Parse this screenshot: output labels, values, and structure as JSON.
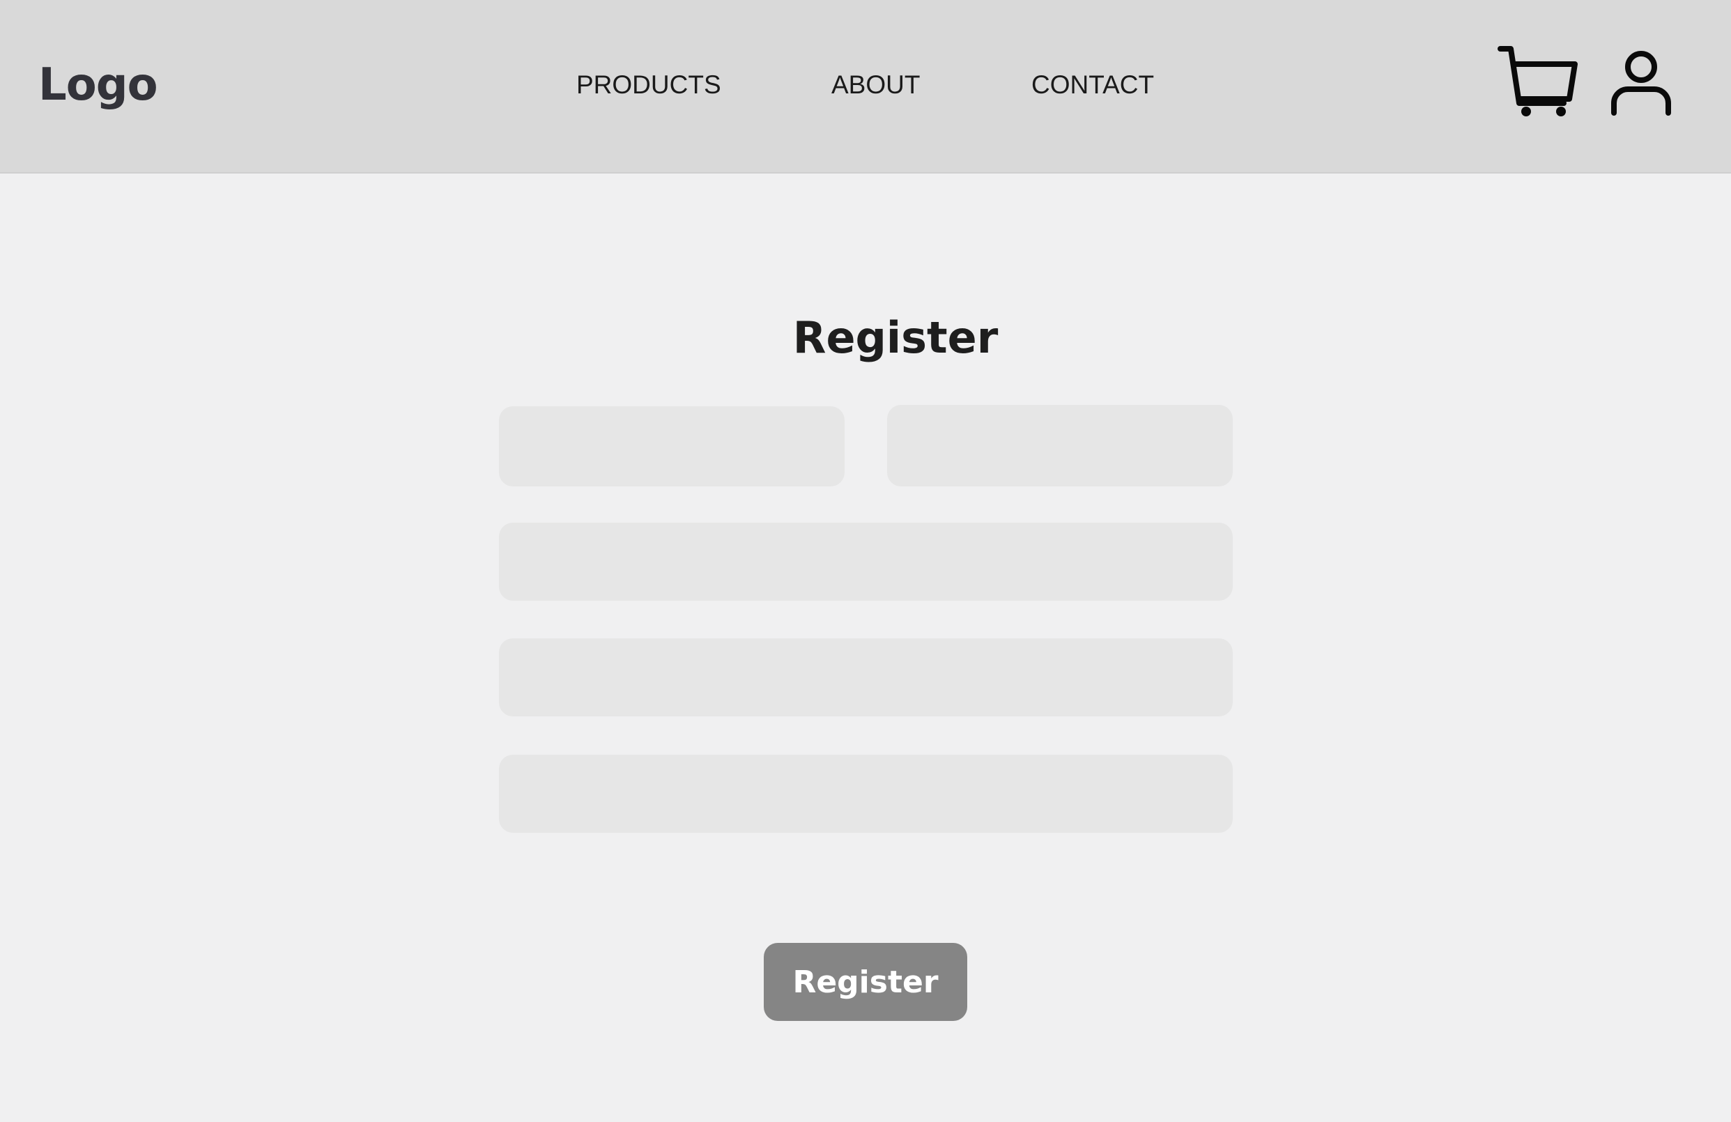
{
  "header": {
    "logo": "Logo",
    "nav": [
      {
        "label": "PRODUCTS"
      },
      {
        "label": "ABOUT"
      },
      {
        "label": "CONTACT"
      }
    ],
    "icons": {
      "cart": "shopping-cart-icon",
      "user": "user-icon"
    }
  },
  "form": {
    "title": "Register",
    "fields": [
      {
        "value": "",
        "placeholder": ""
      },
      {
        "value": "",
        "placeholder": ""
      },
      {
        "value": "",
        "placeholder": ""
      },
      {
        "value": "",
        "placeholder": ""
      },
      {
        "value": "",
        "placeholder": ""
      }
    ],
    "submit_label": "Register"
  },
  "colors": {
    "header_bg": "#d9d9d9",
    "page_bg": "#f0f0f1",
    "field_bg": "#e6e6e6",
    "button_bg": "#858585",
    "button_text": "#ffffff"
  }
}
